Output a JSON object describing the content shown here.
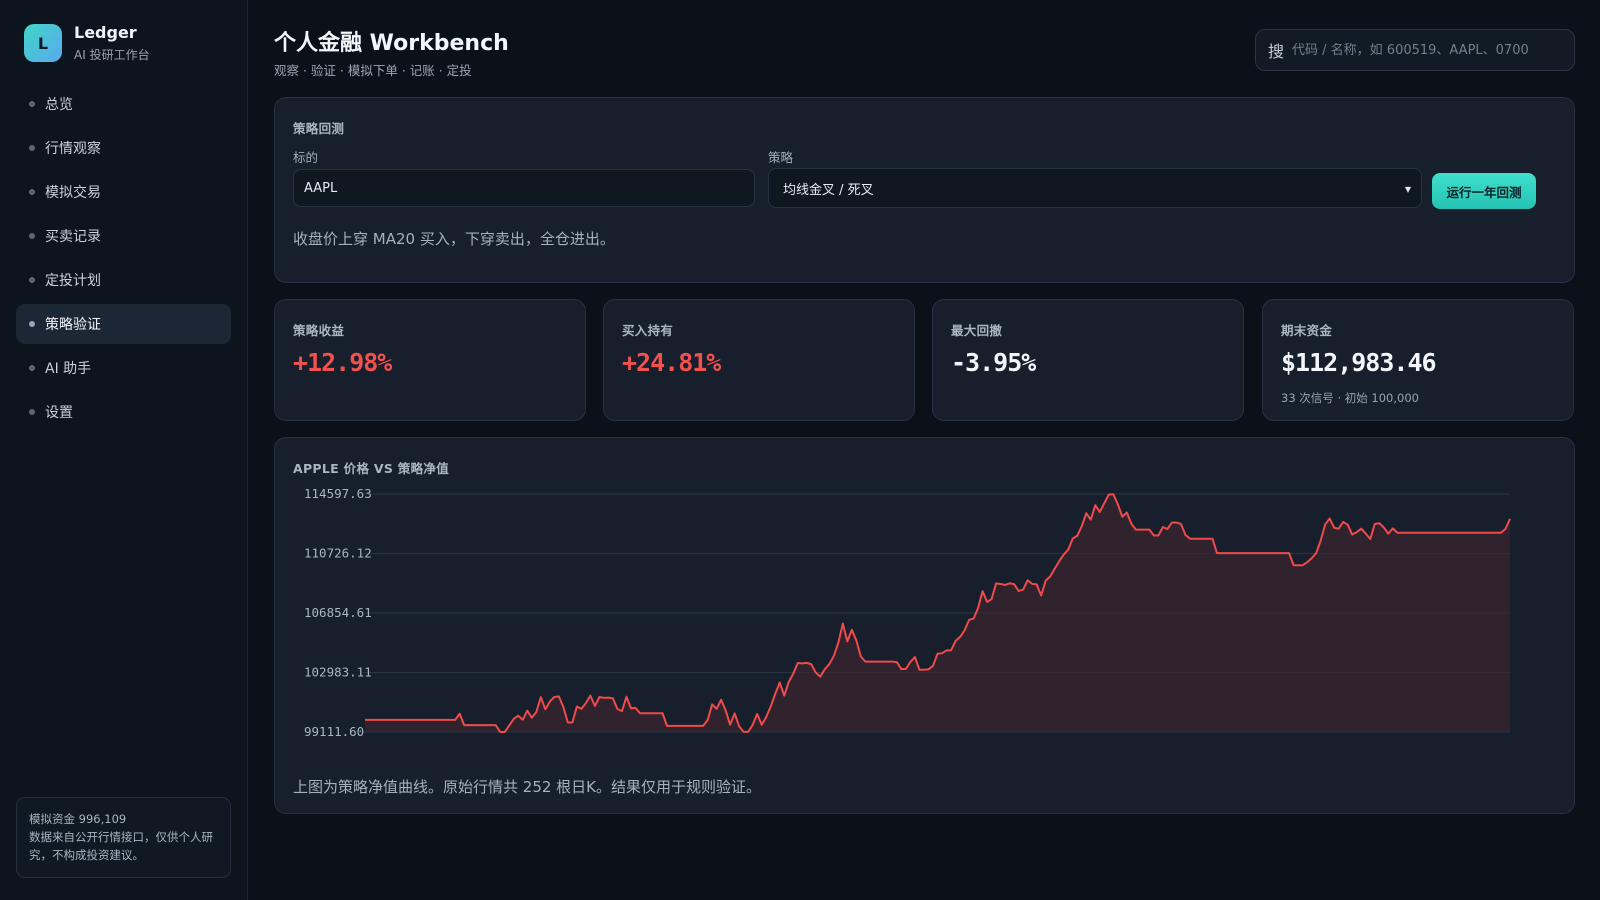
{
  "brand": {
    "logo_letter": "L",
    "name": "Ledger",
    "subtitle": "AI 投研工作台"
  },
  "nav": {
    "items": [
      {
        "label": "总览",
        "active": false
      },
      {
        "label": "行情观察",
        "active": false
      },
      {
        "label": "模拟交易",
        "active": false
      },
      {
        "label": "买卖记录",
        "active": false
      },
      {
        "label": "定投计划",
        "active": false
      },
      {
        "label": "策略验证",
        "active": true
      },
      {
        "label": "AI 助手",
        "active": false
      },
      {
        "label": "设置",
        "active": false
      }
    ]
  },
  "sidebar_note": {
    "line1": "模拟资金 996,109",
    "line2": "数据来自公开行情接口，仅供个人研究，不构成投资建议。"
  },
  "header": {
    "title": "个人金融 Workbench",
    "subtitle": "观察 · 验证 · 模拟下单 · 记账 · 定投",
    "search_icon_label": "搜",
    "search_placeholder": "代码 / 名称，如 600519、AAPL、0700"
  },
  "backtest": {
    "title": "策略回测",
    "symbol_label": "标的",
    "symbol_value": "AAPL",
    "strategy_label": "策略",
    "strategy_value": "均线金叉 / 死叉",
    "run_label": "运行一年回测",
    "description": "收盘价上穿 MA20 买入，下穿卖出，全仓进出。"
  },
  "stats": [
    {
      "title": "策略收益",
      "value": "+12.98%",
      "sub": ""
    },
    {
      "title": "买入持有",
      "value": "+24.81%",
      "sub": ""
    },
    {
      "title": "最大回撤",
      "value": "-3.95%",
      "sub": ""
    },
    {
      "title": "期末资金",
      "value": "$112,983.46",
      "sub": "33 次信号 · 初始 100,000"
    }
  ],
  "colors": {
    "accent": "#2fd3c0",
    "up_red": "#f0514f",
    "line": "#ef4b4b",
    "area": "#3a2530"
  },
  "chart": {
    "title": "APPLE 价格 VS 策略净值",
    "footnote": "上图为策略净值曲线。原始行情共 252 根日K。结果仅用于规则验证。"
  },
  "chart_data": {
    "type": "area",
    "title": "APPLE 价格 VS 策略净值",
    "ylim": [
      99111.6,
      114597.63
    ],
    "yticks": [
      "114597.63",
      "110726.12",
      "106854.61",
      "102983.11",
      "99111.60"
    ],
    "grid": true,
    "series": [
      {
        "values": [
          99900,
          99900,
          99900,
          99900,
          99900,
          99900,
          99900,
          99900,
          99900,
          99900,
          99900,
          99900,
          99900,
          99900,
          99900,
          99900,
          99900,
          99900,
          99900,
          99900,
          99900,
          100300,
          99560,
          99560,
          99560,
          99560,
          99560,
          99560,
          99560,
          99560,
          99110,
          99110,
          99540,
          99970,
          100170,
          99910,
          100500,
          100040,
          100410,
          101380,
          100590,
          101090,
          101390,
          101430,
          100740,
          99730,
          99730,
          100770,
          100620,
          100990,
          101480,
          100810,
          101390,
          101330,
          101350,
          101300,
          100610,
          100470,
          101410,
          100660,
          100680,
          100330,
          100330,
          100330,
          100330,
          100330,
          100330,
          99510,
          99510,
          99510,
          99510,
          99510,
          99510,
          99510,
          99510,
          99510,
          99890,
          100900,
          100620,
          101210,
          100520,
          99590,
          100320,
          99480,
          99120,
          99120,
          99580,
          100280,
          99580,
          100080,
          100770,
          101590,
          102330,
          101480,
          102370,
          102900,
          103600,
          103580,
          103610,
          103520,
          102980,
          102710,
          103200,
          103530,
          104060,
          104920,
          106160,
          105010,
          105760,
          105070,
          104020,
          103690,
          103690,
          103690,
          103690,
          103690,
          103690,
          103690,
          103650,
          103200,
          103220,
          103680,
          103990,
          103160,
          103160,
          103190,
          103420,
          104200,
          104240,
          104420,
          104430,
          105030,
          105290,
          105720,
          106410,
          106490,
          107180,
          108270,
          107580,
          107760,
          108780,
          108740,
          108680,
          108790,
          108730,
          108290,
          108380,
          108980,
          108750,
          108720,
          107990,
          108960,
          109240,
          109740,
          110230,
          110660,
          110980,
          111700,
          111880,
          112500,
          113340,
          112930,
          113870,
          113430,
          114000,
          114560,
          114580,
          113940,
          113120,
          113390,
          112670,
          112280,
          112280,
          112280,
          112280,
          111900,
          111900,
          112450,
          112320,
          112740,
          112740,
          112650,
          111940,
          111690,
          111690,
          111690,
          111690,
          111690,
          111690,
          110750,
          110750,
          110750,
          110750,
          110750,
          110750,
          110750,
          110750,
          110750,
          110750,
          110750,
          110750,
          110750,
          110750,
          110750,
          110750,
          110750,
          109960,
          109960,
          109960,
          110160,
          110420,
          110750,
          111570,
          112620,
          113000,
          112400,
          112340,
          112780,
          112600,
          111960,
          112120,
          112340,
          112020,
          111670,
          112640,
          112700,
          112420,
          112020,
          112360,
          112080,
          112080,
          112080,
          112080,
          112080,
          112080,
          112080,
          112080,
          112080,
          112080,
          112080,
          112080,
          112080,
          112080,
          112080,
          112080,
          112080,
          112080,
          112080,
          112080,
          112080,
          112080,
          112080,
          112080,
          112330,
          112983.46
        ]
      }
    ]
  }
}
